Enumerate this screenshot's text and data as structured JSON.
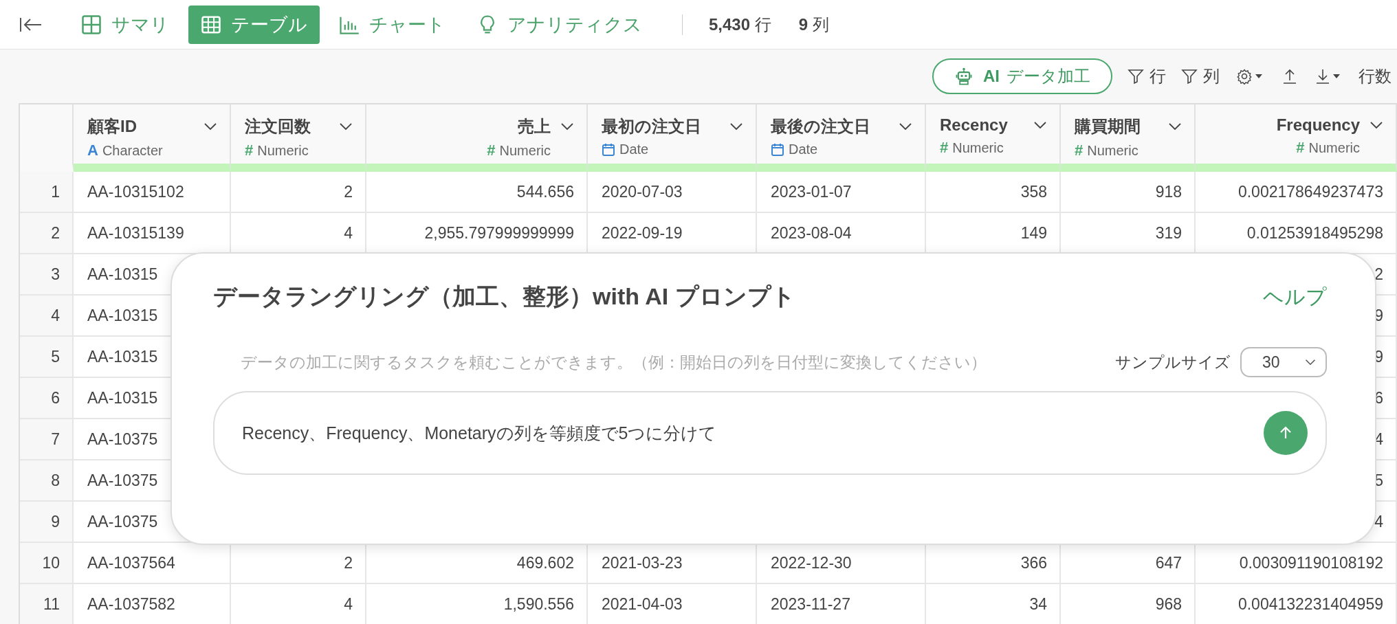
{
  "nav": {
    "tabs": [
      {
        "label": "サマリ",
        "kind": "summary",
        "selected": false
      },
      {
        "label": "テーブル",
        "kind": "table",
        "selected": true
      },
      {
        "label": "チャート",
        "kind": "chart",
        "selected": false
      },
      {
        "label": "アナリティクス",
        "kind": "analytics",
        "selected": false
      }
    ],
    "row_count": "5,430",
    "row_unit": "行",
    "col_count": "9",
    "col_unit": "列"
  },
  "toolbar": {
    "ai_button": {
      "prefix": "AI",
      "label": "データ加工"
    },
    "row_filter": "行",
    "col_filter": "列",
    "row_count_label": "行数"
  },
  "table": {
    "columns": [
      {
        "name": "顧客ID",
        "type": "Character",
        "kind": "character",
        "symbol": "A"
      },
      {
        "name": "注文回数",
        "type": "Numeric",
        "kind": "numeric",
        "symbol": "#"
      },
      {
        "name": "売上",
        "type": "Numeric",
        "kind": "numeric",
        "symbol": "#"
      },
      {
        "name": "最初の注文日",
        "type": "Date",
        "kind": "date"
      },
      {
        "name": "最後の注文日",
        "type": "Date",
        "kind": "date"
      },
      {
        "name": "Recency",
        "type": "Numeric",
        "kind": "numeric",
        "symbol": "#"
      },
      {
        "name": "購買期間",
        "type": "Numeric",
        "kind": "numeric",
        "symbol": "#"
      },
      {
        "name": "Frequency",
        "type": "Numeric",
        "kind": "numeric",
        "symbol": "#"
      }
    ],
    "rows": [
      {
        "number": "1",
        "cells": [
          "AA-10315102",
          "2",
          "544.656",
          "2020-07-03",
          "2023-01-07",
          "358",
          "918",
          "0.002178649237473"
        ]
      },
      {
        "number": "2",
        "cells": [
          "AA-10315139",
          "4",
          "2,955.797999999999",
          "2022-09-19",
          "2023-08-04",
          "149",
          "319",
          "0.01253918495298"
        ]
      },
      {
        "number": "3",
        "cells": [
          "AA-10315",
          null,
          null,
          null,
          null,
          null,
          null,
          "2"
        ]
      },
      {
        "number": "4",
        "cells": [
          "AA-10315",
          null,
          null,
          null,
          null,
          null,
          null,
          "9"
        ]
      },
      {
        "number": "5",
        "cells": [
          "AA-10315",
          null,
          null,
          null,
          null,
          null,
          null,
          "9"
        ]
      },
      {
        "number": "6",
        "cells": [
          "AA-10315",
          null,
          null,
          null,
          null,
          null,
          null,
          "6"
        ]
      },
      {
        "number": "7",
        "cells": [
          "AA-10375",
          null,
          null,
          null,
          null,
          null,
          null,
          "4"
        ]
      },
      {
        "number": "8",
        "cells": [
          "AA-10375",
          null,
          null,
          null,
          null,
          null,
          null,
          "5"
        ]
      },
      {
        "number": "9",
        "cells": [
          "AA-10375",
          null,
          null,
          null,
          null,
          null,
          null,
          "4"
        ]
      },
      {
        "number": "10",
        "cells": [
          "AA-1037564",
          "2",
          "469.602",
          "2021-03-23",
          "2022-12-30",
          "366",
          "647",
          "0.003091190108192"
        ]
      },
      {
        "number": "11",
        "cells": [
          "AA-1037582",
          "4",
          "1,590.556",
          "2021-04-03",
          "2023-11-27",
          "34",
          "968",
          "0.004132231404959"
        ]
      }
    ]
  },
  "dialog": {
    "title": "データラングリング（加工、整形）with AI プロンプト",
    "help": "ヘルプ",
    "hint": "データの加工に関するタスクを頼むことができます。（例：開始日の列を日付型に変換してください）",
    "sample_label": "サンプルサイズ",
    "sample_value": "30",
    "prompt": "Recency、Frequency、Monetaryの列を等頻度で5つに分けて"
  }
}
